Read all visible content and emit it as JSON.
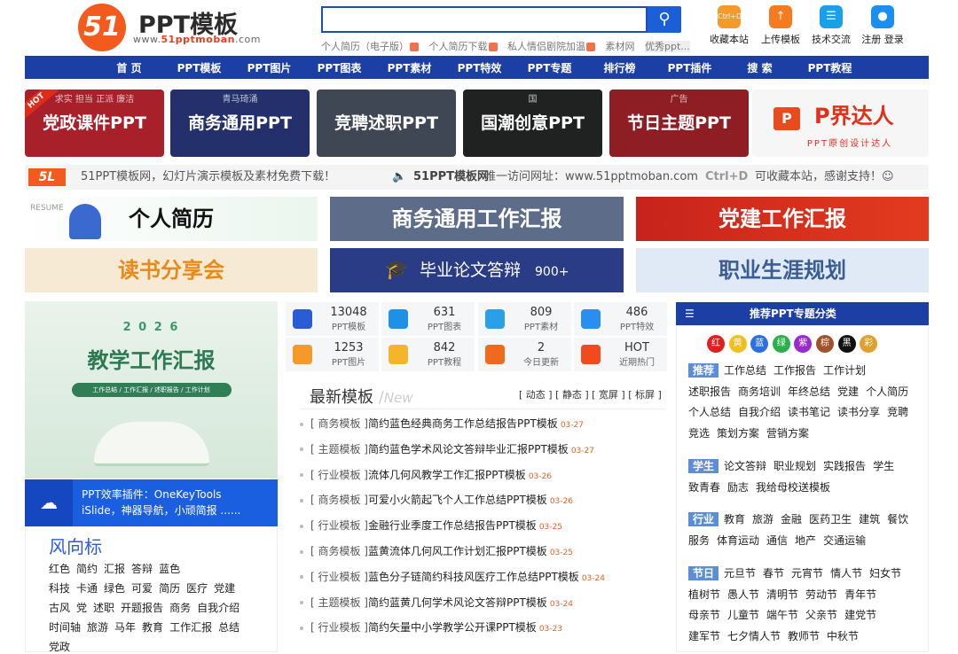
{
  "header": {
    "logo_mark": "51",
    "logo_title": "PPT模板",
    "logo_site_prefix": "www.",
    "logo_site_main": "51pptmoban",
    "logo_site_suffix": ".com",
    "search_placeholder": "",
    "hotwords": [
      "个人简历（电子版）",
      "个人简历下载",
      "私人情侣剧院加温",
      "素材网",
      "优秀ppt..."
    ],
    "tools": [
      {
        "label": "收藏本站",
        "icon": "ctrl-d-icon",
        "glyph": "Ctrl+D",
        "color": "#f39a2b"
      },
      {
        "label": "上传模板",
        "icon": "upload-icon",
        "glyph": "↑",
        "color": "#f47b20"
      },
      {
        "label": "技术交流",
        "icon": "chat-icon",
        "glyph": "☰",
        "color": "#1aa0e8"
      },
      {
        "label": "注册 登录",
        "icon": "user-icon",
        "glyph": "●",
        "color": "#1a8ff0"
      }
    ]
  },
  "nav": [
    "首 页",
    "PPT模板",
    "PPT图片",
    "PPT图表",
    "PPT素材",
    "PPT特效",
    "PPT专题",
    "排行榜",
    "PPT插件",
    "搜 索",
    "PPT教程"
  ],
  "banners": [
    {
      "label": "党政课件PPT",
      "badge": "HOT",
      "sub": "求实 担当 正派 廉洁",
      "color": "#a8202a"
    },
    {
      "label": "商务通用PPT",
      "sub": "青马琦涌",
      "color": "#23306b"
    },
    {
      "label": "竞聘述职PPT",
      "color": "#3f4654"
    },
    {
      "label": "国潮创意PPT",
      "sub": "国",
      "color": "#202121"
    },
    {
      "label": "节日主题PPT",
      "sub": "广告",
      "color": "#8e1e24"
    },
    {
      "label": "P界达人",
      "sub": "PPT原创设计达人",
      "color": "#f6f6f6"
    }
  ],
  "notice": {
    "logo": "5L",
    "left": "51PPT模板网，幻灯片演示模板及素材免费下载！",
    "mid_label": "51PPT模板网",
    "mid_text": "唯一访问网址：www.51pptmoban.com",
    "right_key": "Ctrl+D",
    "right_text": "可收藏本站，感谢支持！☺"
  },
  "ads": [
    {
      "label": "个人简历",
      "sub": "RESUME"
    },
    {
      "label": "商务通用工作汇报"
    },
    {
      "label": "党建工作汇报"
    },
    {
      "label": "读书分享会"
    },
    {
      "label": "毕业论文答辩",
      "sub": "900+"
    },
    {
      "label": "职业生涯规划"
    }
  ],
  "promo": {
    "year": "2 0 2 6",
    "title": "教学工作汇报",
    "tags": "工作总结 / 工作汇报 / 述职报告 / 工作计划"
  },
  "plugin": {
    "line1": "PPT效率插件：OneKeyTools",
    "line2": "iSlide，神器导航，小顽简报 ......"
  },
  "fengxiang": {
    "title": "风向标",
    "rows": [
      [
        "红色",
        "简约",
        "汇报",
        "答辩",
        "蓝色"
      ],
      [
        "科技",
        "卡通",
        "绿色",
        "可爱",
        "简历",
        "医疗",
        "党建"
      ],
      [
        "古风",
        "党",
        "述职",
        "开题报告",
        "商务",
        "自我介绍"
      ],
      [
        "时间轴",
        "旅游",
        "马年",
        "教育",
        "工作汇报",
        "总结"
      ],
      [
        "党政"
      ]
    ]
  },
  "stats": [
    {
      "num": "13048",
      "label": "PPT模板",
      "icon": "ppt-icon",
      "color": "#2a5cd8"
    },
    {
      "num": "631",
      "label": "PPT图表",
      "icon": "chart-icon",
      "color": "#1e90e8"
    },
    {
      "num": "809",
      "label": "PPT素材",
      "icon": "material-icon",
      "color": "#2aa0e8"
    },
    {
      "num": "486",
      "label": "PPT特效",
      "icon": "effect-icon",
      "color": "#2a8ef0"
    },
    {
      "num": "1253",
      "label": "PPT图片",
      "icon": "image-icon",
      "color": "#f39a2b"
    },
    {
      "num": "842",
      "label": "PPT教程",
      "icon": "tutorial-icon",
      "color": "#f3b52b"
    },
    {
      "num": "2",
      "label": "今日更新",
      "icon": "refresh-icon",
      "color": "#f06a1e"
    },
    {
      "num": "HOT",
      "label": "近期热门",
      "icon": "hot-icon",
      "color": "#f04a1e"
    }
  ],
  "latest": {
    "title": "最新模板",
    "title_en": "New",
    "tabs": "[ 动态 ] [ 静态 ] [ 宽屏 ] [ 标屏 ]",
    "items": [
      {
        "tag": "[ 商务模板 ]",
        "title": "简约蓝色经典商务工作总结报告PPT模板",
        "date": "03-27"
      },
      {
        "tag": "[ 主题模板 ]",
        "title": "简约蓝色学术风论文答辩毕业汇报PPT模板",
        "date": "03-27"
      },
      {
        "tag": "[ 行业模板 ]",
        "title": "流体几何风教学工作汇报PPT模板",
        "date": "03-26"
      },
      {
        "tag": "[ 商务模板 ]",
        "title": "可爱小火箭起飞个人工作总结PPT模板",
        "date": "03-26"
      },
      {
        "tag": "[ 行业模板 ]",
        "title": "金融行业季度工作总结报告PPT模板",
        "date": "03-25"
      },
      {
        "tag": "[ 商务模板 ]",
        "title": "蓝黄流体几何风工作计划汇报PPT模板",
        "date": "03-25"
      },
      {
        "tag": "[ 行业模板 ]",
        "title": "蓝色分子链简约科技风医疗工作总结PPT模板",
        "date": "03-24"
      },
      {
        "tag": "[ 主题模板 ]",
        "title": "简约蓝黄几何学术风论文答辩PPT模板",
        "date": "03-24"
      },
      {
        "tag": "[ 行业模板 ]",
        "title": "简约矢量中小学教学公开课PPT模板",
        "date": "03-23"
      }
    ]
  },
  "recommend": {
    "title": "推荐PPT专题分类",
    "colors": [
      {
        "label": "红",
        "color": "#e02020"
      },
      {
        "label": "黄",
        "color": "#f0c020"
      },
      {
        "label": "蓝",
        "color": "#2a70e0"
      },
      {
        "label": "绿",
        "color": "#2ab04a"
      },
      {
        "label": "紫",
        "color": "#9a2ad0"
      },
      {
        "label": "棕",
        "color": "#a0522d"
      },
      {
        "label": "黑",
        "color": "#111111"
      },
      {
        "label": "彩",
        "color": "#e0a030"
      }
    ],
    "groups": [
      {
        "label": "推荐",
        "items": [
          "工作总结",
          "工作报告",
          "工作计划",
          "述职报告",
          "商务培训",
          "年终总结",
          "党建",
          "个人简历",
          "个人总结",
          "自我介绍",
          "读书笔记",
          "读书分享",
          "竞聘",
          "竞选",
          "策划方案",
          "营销方案"
        ]
      },
      {
        "label": "学生",
        "items": [
          "论文答辩",
          "职业规划",
          "实践报告",
          "学生",
          "致青春",
          "励志",
          "我给母校送模板"
        ]
      },
      {
        "label": "行业",
        "items": [
          "教育",
          "旅游",
          "金融",
          "医药卫生",
          "建筑",
          "餐饮",
          "服务",
          "体育运动",
          "通信",
          "地产",
          "交通运输"
        ]
      },
      {
        "label": "节日",
        "items": [
          "元旦节",
          "春节",
          "元宵节",
          "情人节",
          "妇女节",
          "植树节",
          "愚人节",
          "清明节",
          "劳动节",
          "青年节",
          "母亲节",
          "儿童节",
          "端午节",
          "父亲节",
          "建党节",
          "建军节",
          "七夕情人节",
          "教师节",
          "中秋节"
        ]
      }
    ]
  }
}
